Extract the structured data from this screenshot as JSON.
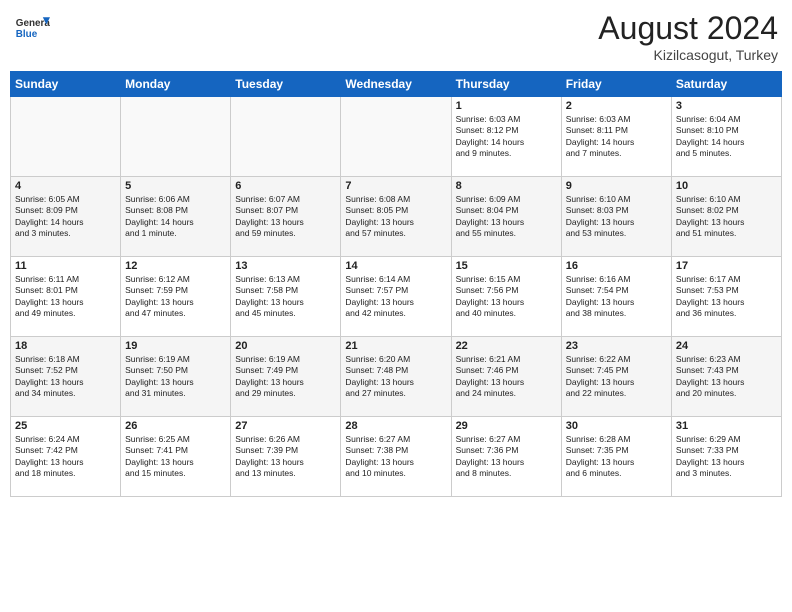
{
  "header": {
    "logo_general": "General",
    "logo_blue": "Blue",
    "month_year": "August 2024",
    "location": "Kizilcasogut, Turkey"
  },
  "weekdays": [
    "Sunday",
    "Monday",
    "Tuesday",
    "Wednesday",
    "Thursday",
    "Friday",
    "Saturday"
  ],
  "weeks": [
    [
      {
        "day": "",
        "info": ""
      },
      {
        "day": "",
        "info": ""
      },
      {
        "day": "",
        "info": ""
      },
      {
        "day": "",
        "info": ""
      },
      {
        "day": "1",
        "info": "Sunrise: 6:03 AM\nSunset: 8:12 PM\nDaylight: 14 hours\nand 9 minutes."
      },
      {
        "day": "2",
        "info": "Sunrise: 6:03 AM\nSunset: 8:11 PM\nDaylight: 14 hours\nand 7 minutes."
      },
      {
        "day": "3",
        "info": "Sunrise: 6:04 AM\nSunset: 8:10 PM\nDaylight: 14 hours\nand 5 minutes."
      }
    ],
    [
      {
        "day": "4",
        "info": "Sunrise: 6:05 AM\nSunset: 8:09 PM\nDaylight: 14 hours\nand 3 minutes."
      },
      {
        "day": "5",
        "info": "Sunrise: 6:06 AM\nSunset: 8:08 PM\nDaylight: 14 hours\nand 1 minute."
      },
      {
        "day": "6",
        "info": "Sunrise: 6:07 AM\nSunset: 8:07 PM\nDaylight: 13 hours\nand 59 minutes."
      },
      {
        "day": "7",
        "info": "Sunrise: 6:08 AM\nSunset: 8:05 PM\nDaylight: 13 hours\nand 57 minutes."
      },
      {
        "day": "8",
        "info": "Sunrise: 6:09 AM\nSunset: 8:04 PM\nDaylight: 13 hours\nand 55 minutes."
      },
      {
        "day": "9",
        "info": "Sunrise: 6:10 AM\nSunset: 8:03 PM\nDaylight: 13 hours\nand 53 minutes."
      },
      {
        "day": "10",
        "info": "Sunrise: 6:10 AM\nSunset: 8:02 PM\nDaylight: 13 hours\nand 51 minutes."
      }
    ],
    [
      {
        "day": "11",
        "info": "Sunrise: 6:11 AM\nSunset: 8:01 PM\nDaylight: 13 hours\nand 49 minutes."
      },
      {
        "day": "12",
        "info": "Sunrise: 6:12 AM\nSunset: 7:59 PM\nDaylight: 13 hours\nand 47 minutes."
      },
      {
        "day": "13",
        "info": "Sunrise: 6:13 AM\nSunset: 7:58 PM\nDaylight: 13 hours\nand 45 minutes."
      },
      {
        "day": "14",
        "info": "Sunrise: 6:14 AM\nSunset: 7:57 PM\nDaylight: 13 hours\nand 42 minutes."
      },
      {
        "day": "15",
        "info": "Sunrise: 6:15 AM\nSunset: 7:56 PM\nDaylight: 13 hours\nand 40 minutes."
      },
      {
        "day": "16",
        "info": "Sunrise: 6:16 AM\nSunset: 7:54 PM\nDaylight: 13 hours\nand 38 minutes."
      },
      {
        "day": "17",
        "info": "Sunrise: 6:17 AM\nSunset: 7:53 PM\nDaylight: 13 hours\nand 36 minutes."
      }
    ],
    [
      {
        "day": "18",
        "info": "Sunrise: 6:18 AM\nSunset: 7:52 PM\nDaylight: 13 hours\nand 34 minutes."
      },
      {
        "day": "19",
        "info": "Sunrise: 6:19 AM\nSunset: 7:50 PM\nDaylight: 13 hours\nand 31 minutes."
      },
      {
        "day": "20",
        "info": "Sunrise: 6:19 AM\nSunset: 7:49 PM\nDaylight: 13 hours\nand 29 minutes."
      },
      {
        "day": "21",
        "info": "Sunrise: 6:20 AM\nSunset: 7:48 PM\nDaylight: 13 hours\nand 27 minutes."
      },
      {
        "day": "22",
        "info": "Sunrise: 6:21 AM\nSunset: 7:46 PM\nDaylight: 13 hours\nand 24 minutes."
      },
      {
        "day": "23",
        "info": "Sunrise: 6:22 AM\nSunset: 7:45 PM\nDaylight: 13 hours\nand 22 minutes."
      },
      {
        "day": "24",
        "info": "Sunrise: 6:23 AM\nSunset: 7:43 PM\nDaylight: 13 hours\nand 20 minutes."
      }
    ],
    [
      {
        "day": "25",
        "info": "Sunrise: 6:24 AM\nSunset: 7:42 PM\nDaylight: 13 hours\nand 18 minutes."
      },
      {
        "day": "26",
        "info": "Sunrise: 6:25 AM\nSunset: 7:41 PM\nDaylight: 13 hours\nand 15 minutes."
      },
      {
        "day": "27",
        "info": "Sunrise: 6:26 AM\nSunset: 7:39 PM\nDaylight: 13 hours\nand 13 minutes."
      },
      {
        "day": "28",
        "info": "Sunrise: 6:27 AM\nSunset: 7:38 PM\nDaylight: 13 hours\nand 10 minutes."
      },
      {
        "day": "29",
        "info": "Sunrise: 6:27 AM\nSunset: 7:36 PM\nDaylight: 13 hours\nand 8 minutes."
      },
      {
        "day": "30",
        "info": "Sunrise: 6:28 AM\nSunset: 7:35 PM\nDaylight: 13 hours\nand 6 minutes."
      },
      {
        "day": "31",
        "info": "Sunrise: 6:29 AM\nSunset: 7:33 PM\nDaylight: 13 hours\nand 3 minutes."
      }
    ]
  ]
}
